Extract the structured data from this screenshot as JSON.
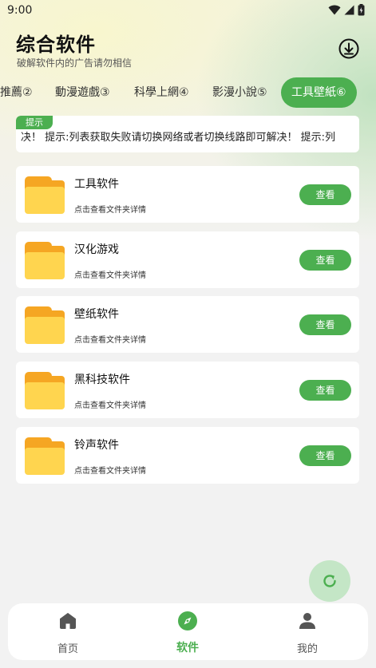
{
  "status_bar": {
    "time": "9:00"
  },
  "header": {
    "title": "综合软件",
    "subtitle": "破解软件内的广告请勿相信"
  },
  "tabs": [
    {
      "label": "推薦②"
    },
    {
      "label": "動漫遊戲③"
    },
    {
      "label": "科學上網④"
    },
    {
      "label": "影漫小說⑤"
    },
    {
      "label": "工具壁紙⑥"
    }
  ],
  "notice": {
    "tag": "提示",
    "text": "决！    提示:列表获取失败请切换网络或者切换线路即可解决！    提示:列"
  },
  "list": [
    {
      "title": "工具软件",
      "desc": "点击查看文件夹详情",
      "button": "查看"
    },
    {
      "title": "汉化游戏",
      "desc": "点击查看文件夹详情",
      "button": "查看"
    },
    {
      "title": "壁纸软件",
      "desc": "点击查看文件夹详情",
      "button": "查看"
    },
    {
      "title": "黑科技软件",
      "desc": "点击查看文件夹详情",
      "button": "查看"
    },
    {
      "title": "铃声软件",
      "desc": "点击查看文件夹详情",
      "button": "查看"
    }
  ],
  "bottom_nav": {
    "items": [
      {
        "label": "首页",
        "icon": "home-icon"
      },
      {
        "label": "软件",
        "icon": "compass-icon"
      },
      {
        "label": "我的",
        "icon": "person-icon"
      }
    ]
  },
  "colors": {
    "accent": "#4caf50",
    "folder": "#ffd54f",
    "folder_back": "#f5a623"
  }
}
